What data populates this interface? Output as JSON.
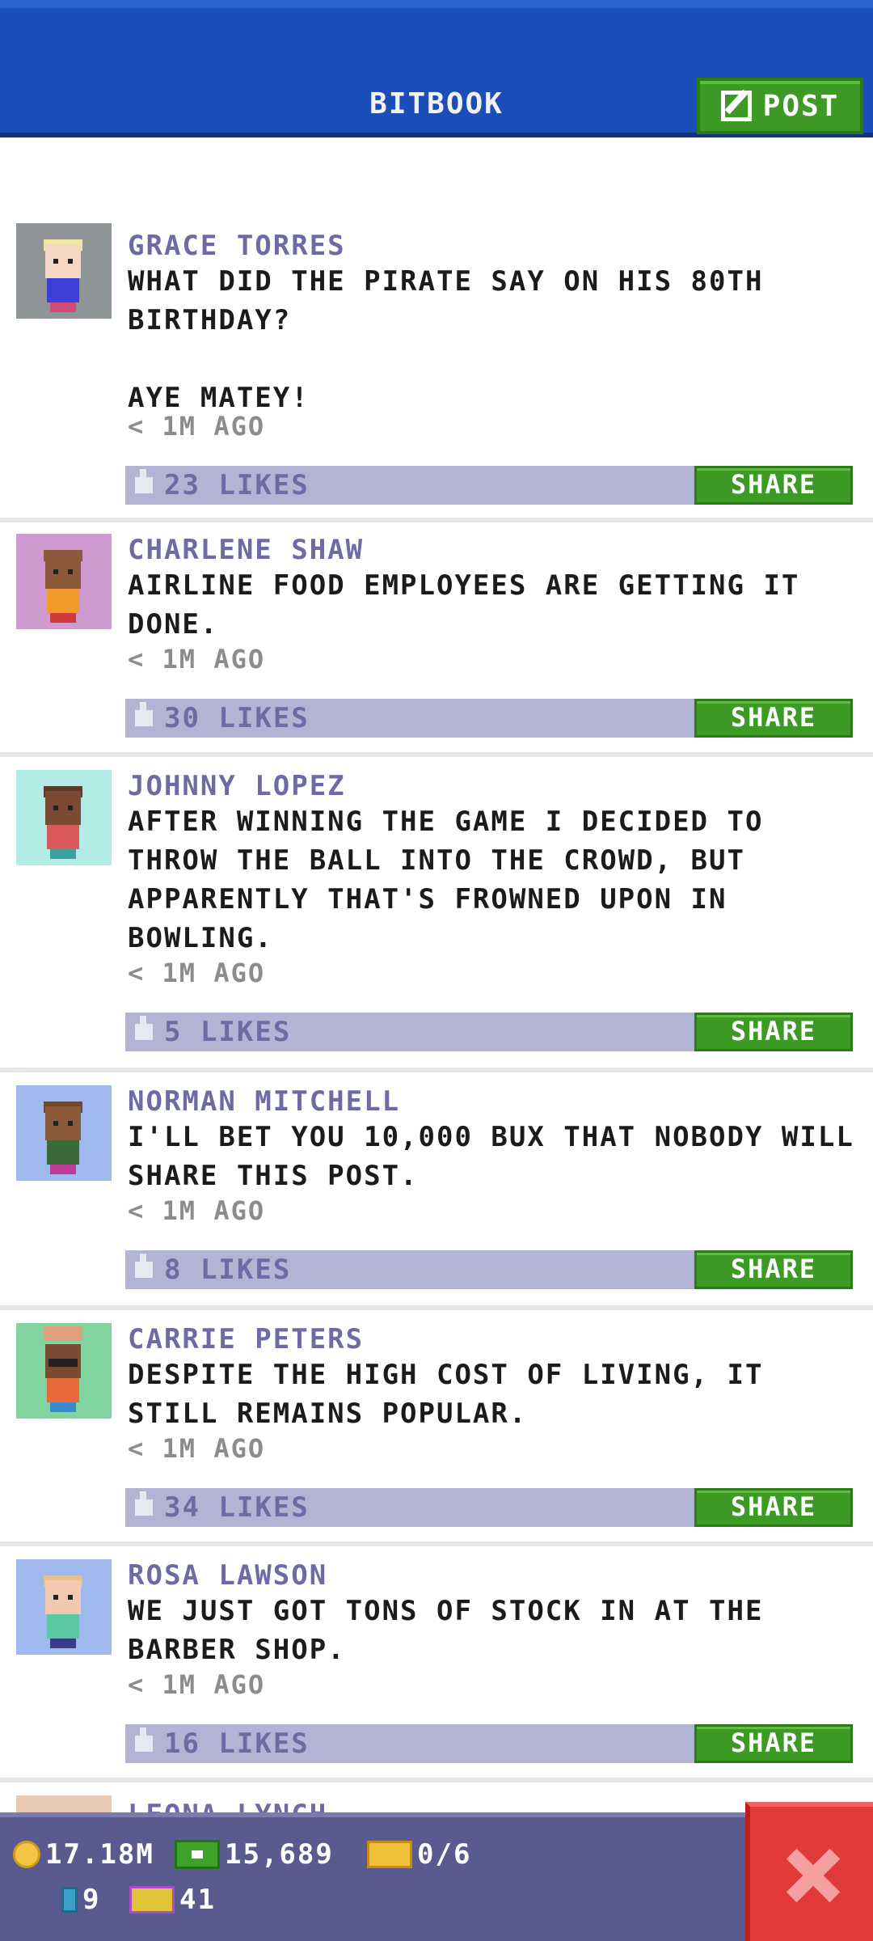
{
  "header": {
    "title": "BITBOOK",
    "post_label": "POST"
  },
  "posts": [
    {
      "name": "GRACE TORRES",
      "message": "WHAT DID THE PIRATE SAY ON HIS 80TH BIRTHDAY?\n\nAYE MATEY!",
      "time": "< 1M AGO",
      "likes": "23 LIKES",
      "share": "SHARE",
      "avatar_bg": "#8f9597"
    },
    {
      "name": "CHARLENE SHAW",
      "message": "AIRLINE FOOD EMPLOYEES ARE GETTING IT DONE.",
      "time": "< 1M AGO",
      "likes": "30 LIKES",
      "share": "SHARE",
      "avatar_bg": "#cf9ad0"
    },
    {
      "name": "JOHNNY LOPEZ",
      "message": "AFTER WINNING THE GAME I DECIDED TO THROW THE BALL INTO THE CROWD, BUT APPARENTLY THAT'S FROWNED UPON IN BOWLING.",
      "time": "< 1M AGO",
      "likes": "5 LIKES",
      "share": "SHARE",
      "avatar_bg": "#b3ece6"
    },
    {
      "name": "NORMAN MITCHELL",
      "message": "I'LL BET YOU 10,000 BUX THAT NOBODY WILL SHARE THIS POST.",
      "time": "< 1M AGO",
      "likes": "8 LIKES",
      "share": "SHARE",
      "avatar_bg": "#9fb8ee"
    },
    {
      "name": "CARRIE PETERS",
      "message": "DESPITE THE HIGH COST OF LIVING, IT STILL REMAINS POPULAR.",
      "time": "< 1M AGO",
      "likes": "34 LIKES",
      "share": "SHARE",
      "avatar_bg": "#7fd4a0"
    },
    {
      "name": "ROSA LAWSON",
      "message": "WE JUST GOT TONS OF STOCK IN AT THE BARBER SHOP.",
      "time": "< 1M AGO",
      "likes": "16 LIKES",
      "share": "SHARE",
      "avatar_bg": "#9fb8ee"
    },
    {
      "name": "LEONA LYNCH",
      "message": "",
      "time": "",
      "likes": "",
      "share": "",
      "avatar_bg": "#9fb8ee"
    }
  ],
  "status": {
    "coins": "17.18M",
    "bux": "15,689",
    "tickets": "0/6",
    "floors": "9",
    "vip": "41"
  }
}
